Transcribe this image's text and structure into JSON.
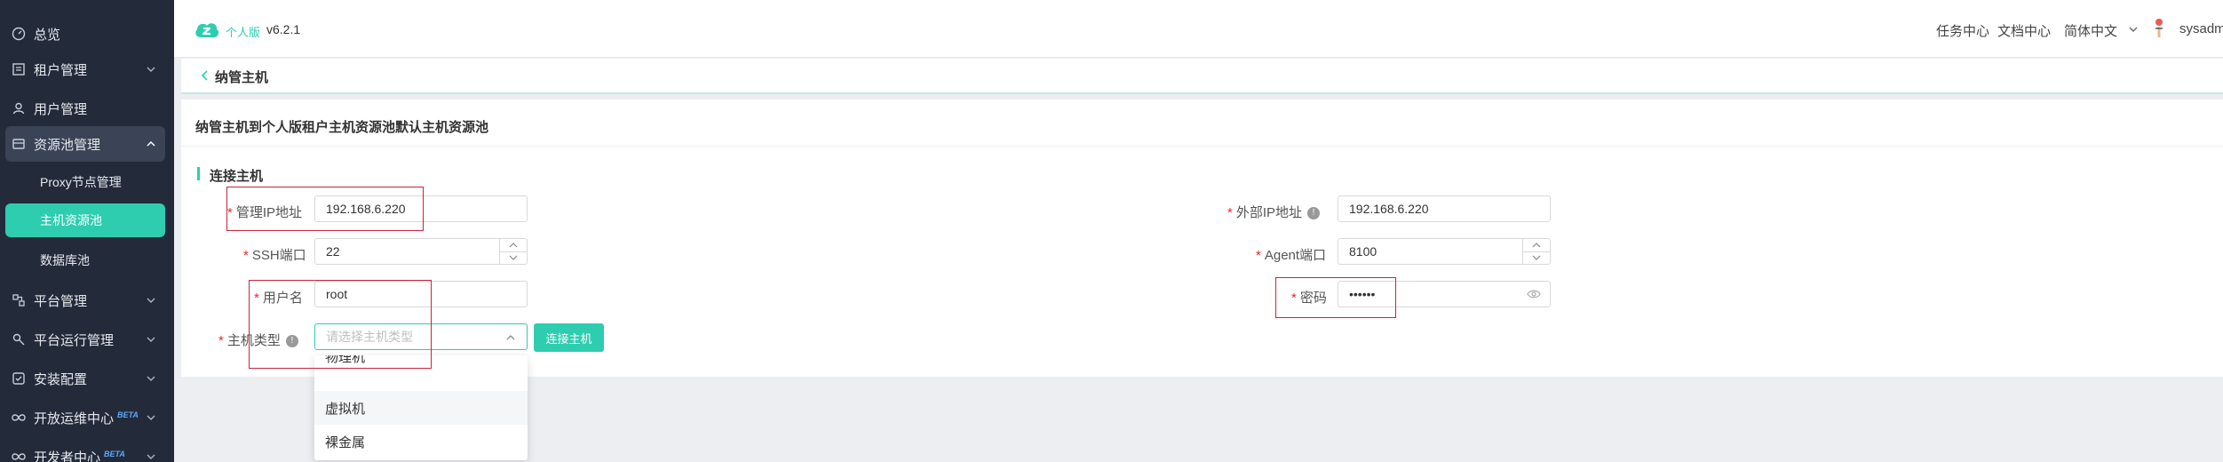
{
  "sidebar": {
    "items": [
      {
        "label": "总览",
        "icon": "dashboard-icon",
        "expandable": false
      },
      {
        "label": "租户管理",
        "icon": "tenant-icon",
        "expandable": true
      },
      {
        "label": "用户管理",
        "icon": "user-icon",
        "expandable": false
      },
      {
        "label": "资源池管理",
        "icon": "resource-pool-icon",
        "expandable": true,
        "expanded": true
      },
      {
        "label": "平台管理",
        "icon": "platform-icon",
        "expandable": true
      },
      {
        "label": "平台运行管理",
        "icon": "platform-run-icon",
        "expandable": true
      },
      {
        "label": "安装配置",
        "icon": "install-config-icon",
        "expandable": true
      },
      {
        "label": "开放运维中心",
        "icon": "ops-center-icon",
        "expandable": true,
        "badge": "BETA"
      },
      {
        "label": "开发者中心",
        "icon": "developer-center-icon",
        "expandable": true,
        "badge": "BETA"
      }
    ],
    "sub_items": [
      {
        "label": "Proxy节点管理",
        "active": false
      },
      {
        "label": "主机资源池",
        "active": true
      },
      {
        "label": "数据库池",
        "active": false
      }
    ]
  },
  "header": {
    "brand": "个人版",
    "version": "v6.2.1",
    "links": {
      "tasks": "任务中心",
      "docs": "文档中心",
      "language": "简体中文",
      "user": "sysadm"
    }
  },
  "breadcrumb": {
    "title": "纳管主机"
  },
  "card": {
    "title": "纳管主机到个人版租户主机资源池默认主机资源池",
    "section": "连接主机"
  },
  "form": {
    "mgmt_ip": {
      "label": "管理IP地址",
      "value": "192.168.6.220"
    },
    "external_ip": {
      "label": "外部IP地址",
      "value": "192.168.6.220"
    },
    "ssh_port": {
      "label": "SSH端口",
      "value": "22"
    },
    "agent_port": {
      "label": "Agent端口",
      "value": "8100"
    },
    "username": {
      "label": "用户名",
      "value": "root"
    },
    "password": {
      "label": "密码",
      "value": "••••••"
    },
    "host_type": {
      "label": "主机类型",
      "placeholder": "请选择主机类型"
    },
    "connect_button": "连接主机"
  },
  "dropdown": {
    "options": [
      "物理机",
      "虚拟机",
      "裸金属"
    ],
    "hovered_index": 1
  },
  "colors": {
    "accent": "#2ecdb0",
    "sidebar_bg": "#232b3b",
    "required": "#f5222d",
    "annotation_box": "#c8243b"
  }
}
